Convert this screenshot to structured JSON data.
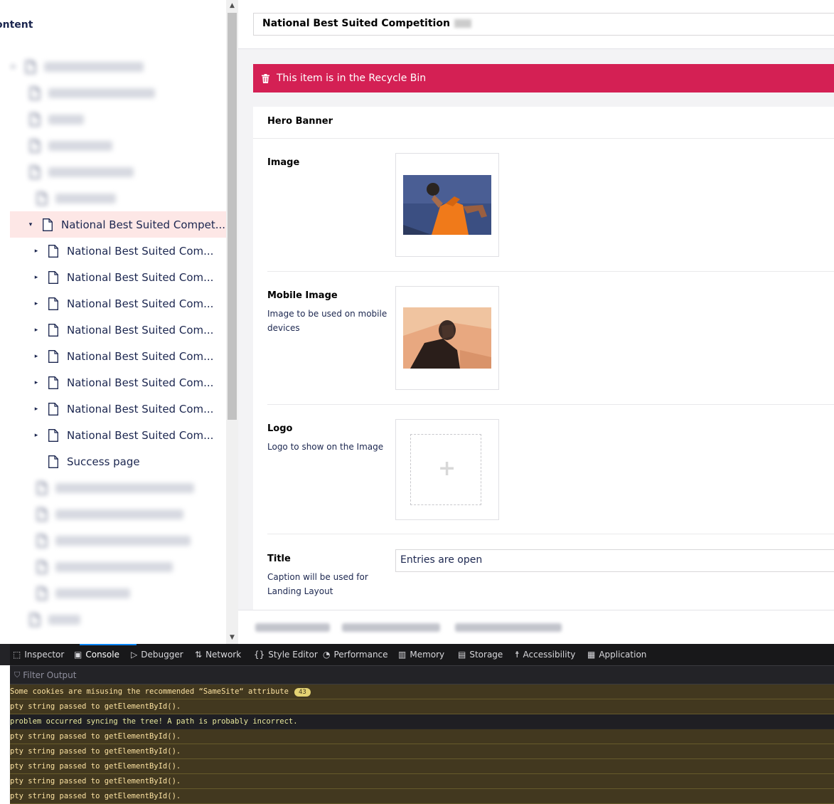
{
  "tree": {
    "heading": "ontent",
    "nodes": [
      {
        "label": "",
        "blurred": true,
        "arrow": "▸",
        "indent": 0,
        "bar": 140
      },
      {
        "label": "",
        "blurred": true,
        "arrow": "",
        "indent": 1,
        "bar": 150
      },
      {
        "label": "",
        "blurred": true,
        "arrow": "",
        "indent": 1,
        "bar": 50
      },
      {
        "label": "",
        "blurred": true,
        "arrow": "",
        "indent": 1,
        "bar": 90
      },
      {
        "label": "",
        "blurred": true,
        "arrow": "",
        "indent": 1,
        "bar": 120
      },
      {
        "label": "",
        "blurred": true,
        "arrow": "",
        "indent": 2,
        "bar": 85
      },
      {
        "label": "National Best Suited Compet...",
        "blurred": false,
        "arrow": "▾",
        "indent": 2,
        "selected": true
      },
      {
        "label": "National Best Suited Com...",
        "blurred": false,
        "arrow": "▸",
        "indent": 3
      },
      {
        "label": "National Best Suited Com...",
        "blurred": false,
        "arrow": "▸",
        "indent": 3
      },
      {
        "label": "National Best Suited Com...",
        "blurred": false,
        "arrow": "▸",
        "indent": 3
      },
      {
        "label": "National Best Suited Com...",
        "blurred": false,
        "arrow": "▸",
        "indent": 3
      },
      {
        "label": "National Best Suited Com...",
        "blurred": false,
        "arrow": "▸",
        "indent": 3
      },
      {
        "label": "National Best Suited Com...",
        "blurred": false,
        "arrow": "▸",
        "indent": 3
      },
      {
        "label": "National Best Suited Com...",
        "blurred": false,
        "arrow": "▸",
        "indent": 3
      },
      {
        "label": "National Best Suited Com...",
        "blurred": false,
        "arrow": "▸",
        "indent": 3
      },
      {
        "label": "Success page",
        "blurred": false,
        "arrow": "",
        "indent": 3
      },
      {
        "label": "",
        "blurred": true,
        "arrow": "",
        "indent": 2,
        "bar": 195
      },
      {
        "label": "",
        "blurred": true,
        "arrow": "",
        "indent": 2,
        "bar": 180
      },
      {
        "label": "",
        "blurred": true,
        "arrow": "",
        "indent": 2,
        "bar": 190
      },
      {
        "label": "",
        "blurred": true,
        "arrow": "",
        "indent": 2,
        "bar": 165
      },
      {
        "label": "",
        "blurred": true,
        "arrow": "",
        "indent": 2,
        "bar": 105
      },
      {
        "label": "",
        "blurred": true,
        "arrow": "",
        "indent": 1,
        "bar": 45
      }
    ]
  },
  "editor": {
    "name": "National Best Suited Competition",
    "recycle_notice": "This item is in the Recycle Bin",
    "group_title": "Hero Banner",
    "properties": {
      "image": {
        "label": "Image"
      },
      "mobile_image": {
        "label": "Mobile Image",
        "description": "Image to be used on mobile devices"
      },
      "logo": {
        "label": "Logo",
        "description": "Logo to show on the Image"
      },
      "title": {
        "label": "Title",
        "description": "Caption will be used for Landing Layout",
        "value": "Entries are open"
      }
    }
  },
  "devtools": {
    "tabs": [
      {
        "label": "Inspector",
        "icon": "inspector-icon",
        "glyph": "⬚"
      },
      {
        "label": "Console",
        "icon": "console-icon",
        "glyph": "▣",
        "active": true
      },
      {
        "label": "Debugger",
        "icon": "debugger-icon",
        "glyph": "▷"
      },
      {
        "label": "Network",
        "icon": "network-icon",
        "glyph": "⇅"
      },
      {
        "label": "Style Editor",
        "icon": "style-editor-icon",
        "glyph": "{}"
      },
      {
        "label": "Performance",
        "icon": "performance-icon",
        "glyph": "◔"
      },
      {
        "label": "Memory",
        "icon": "memory-icon",
        "glyph": "▥"
      },
      {
        "label": "Storage",
        "icon": "storage-icon",
        "glyph": "▤"
      },
      {
        "label": "Accessibility",
        "icon": "accessibility-icon",
        "glyph": "☨"
      },
      {
        "label": "Application",
        "icon": "application-icon",
        "glyph": "▦"
      }
    ],
    "filter_placeholder": "Filter Output",
    "log": [
      {
        "text": "Some cookies are misusing the recommended “SameSite“ attribute",
        "type": "warn",
        "count": "43"
      },
      {
        "text": "pty string passed to getElementById().",
        "type": "warn"
      },
      {
        "text": "problem occurred syncing the tree! A path is probably incorrect.",
        "type": "err"
      },
      {
        "text": "pty string passed to getElementById().",
        "type": "warn"
      },
      {
        "text": "pty string passed to getElementById().",
        "type": "warn"
      },
      {
        "text": "pty string passed to getElementById().",
        "type": "warn"
      },
      {
        "text": "pty string passed to getElementById().",
        "type": "warn"
      },
      {
        "text": "pty string passed to getElementById().",
        "type": "warn"
      }
    ]
  },
  "colors": {
    "recycle_bg": "#d42054",
    "selected_bg": "#fde7e6",
    "accent": "#1b264f",
    "devtools_active": "#0a84ff"
  }
}
